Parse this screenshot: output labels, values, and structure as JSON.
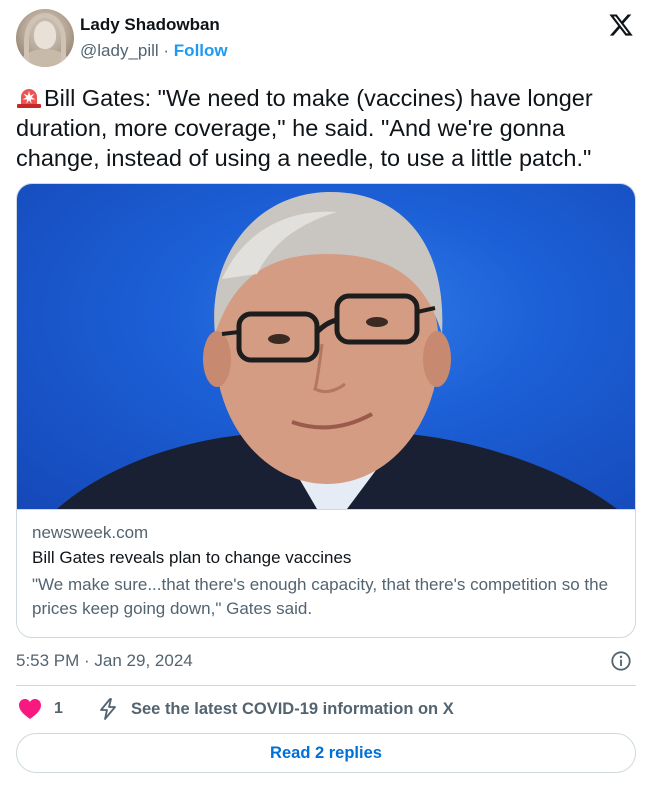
{
  "author": {
    "name": "Lady Shadowban",
    "handle": "@lady_pill",
    "separator": " · ",
    "follow_label": "Follow",
    "avatar_icon": "statue-avatar"
  },
  "platform_icon": "x-logo-icon",
  "tweet": {
    "emoji": "rotating-light-icon",
    "text": "Bill Gates: \"We need to make (vaccines) have longer duration, more coverage,\" he said. \"And we're gonna change, instead of using a needle, to use a little patch.\""
  },
  "card": {
    "image_icon": "bill-gates-photo",
    "domain": "newsweek.com",
    "title": "Bill Gates reveals plan to change vaccines",
    "description": "\"We make sure...that there's enough capacity, that there's competition so the prices keep going down,\" Gates said."
  },
  "timestamp": "5:53 PM · Jan 29, 2024",
  "actions": {
    "like_count": "1",
    "covid_info": "See the latest COVID-19 information on X"
  },
  "replies_button": "Read 2 replies",
  "colors": {
    "accent": "#1d9bf0",
    "like": "#f91880",
    "link": "#006fd6",
    "secondary_text": "#536471"
  }
}
